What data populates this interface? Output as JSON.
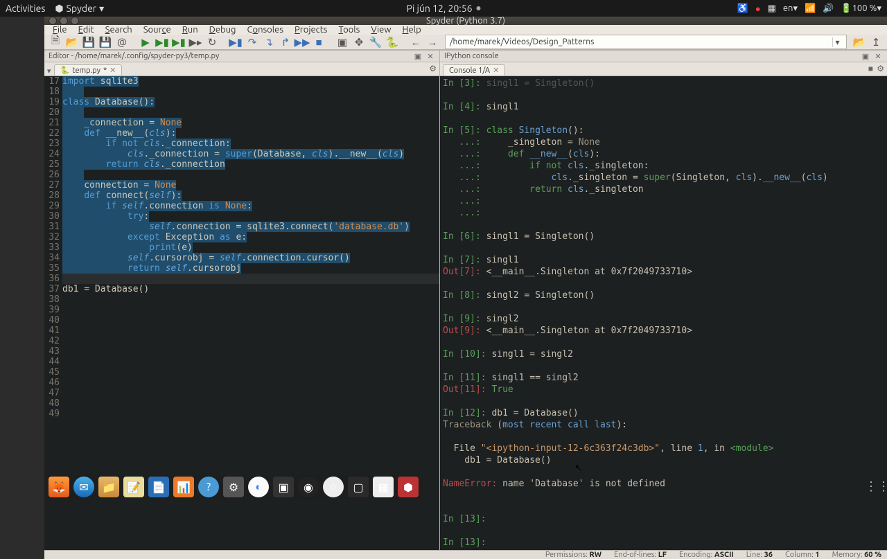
{
  "topbar": {
    "activities": "Activities",
    "app": "Spyder",
    "datetime": "Pi jún 12, 20:56",
    "lang": "en",
    "battery": "100 %"
  },
  "window": {
    "title": "Spyder (Python 3.7)"
  },
  "menu": {
    "items": [
      "File",
      "Edit",
      "Search",
      "Source",
      "Run",
      "Debug",
      "Consoles",
      "Projects",
      "Tools",
      "View",
      "Help"
    ]
  },
  "toolbar": {
    "path": "/home/marek/Videos/Design_Patterns"
  },
  "editor": {
    "header": "Editor - /home/marek/.config/spyder-py3/temp.py",
    "tab": "temp.py",
    "dirty": "*",
    "lines": [
      {
        "n": 17,
        "text": "import sqlite3"
      },
      {
        "n": 18,
        "text": ""
      },
      {
        "n": 19,
        "text": "class Database():"
      },
      {
        "n": 20,
        "text": ""
      },
      {
        "n": 21,
        "text": "    _connection = None"
      },
      {
        "n": 22,
        "text": "    def __new__(cls):"
      },
      {
        "n": 23,
        "text": "        if not cls._connection:"
      },
      {
        "n": 24,
        "text": "            cls._connection = super(Database, cls).__new__(cls)"
      },
      {
        "n": 25,
        "text": "        return cls._connection"
      },
      {
        "n": 26,
        "text": ""
      },
      {
        "n": 27,
        "text": "    connection = None"
      },
      {
        "n": 28,
        "text": "    def connect(self):"
      },
      {
        "n": 29,
        "text": "        if self.connection is None:"
      },
      {
        "n": 30,
        "text": "            try:"
      },
      {
        "n": 31,
        "text": "                self.connection = sqlite3.connect('database.db')"
      },
      {
        "n": 32,
        "text": "            except Exception as e:"
      },
      {
        "n": 33,
        "text": "                print(e)"
      },
      {
        "n": 34,
        "text": "            self.cursorobj = self.connection.cursor()"
      },
      {
        "n": 35,
        "text": "            return self.cursorobj"
      },
      {
        "n": 36,
        "text": ""
      },
      {
        "n": 37,
        "text": "db1 = Database()"
      },
      {
        "n": 38,
        "text": ""
      },
      {
        "n": 39,
        "text": ""
      },
      {
        "n": 40,
        "text": ""
      },
      {
        "n": 41,
        "text": ""
      },
      {
        "n": 42,
        "text": ""
      },
      {
        "n": 43,
        "text": ""
      },
      {
        "n": 44,
        "text": ""
      },
      {
        "n": 45,
        "text": ""
      },
      {
        "n": 46,
        "text": ""
      },
      {
        "n": 47,
        "text": ""
      },
      {
        "n": 48,
        "text": ""
      },
      {
        "n": 49,
        "text": ""
      }
    ]
  },
  "console": {
    "header": "IPython console",
    "tab": "Console 1/A",
    "top_line": {
      "prompt": "In [3]:",
      "text": " singl1 = Singleton()"
    },
    "in4": {
      "prompt": "In [4]:",
      "text": " singl1"
    },
    "in5": {
      "prompt": "In [5]:",
      "head": " class Singleton():",
      "b1": "_singleton = None",
      "b2": "def __new__(cls):",
      "b3": "if not cls._singleton:",
      "b4": "cls._singleton = super(Singleton, cls).__new__(cls)",
      "b5": "return cls._singleton"
    },
    "cont": "   ...:",
    "in6": {
      "prompt": "In [6]:",
      "text": " singl1 = Singleton()"
    },
    "in7": {
      "prompt": "In [7]:",
      "text": " singl1"
    },
    "out7": {
      "prompt": "Out[7]:",
      "text": " <__main__.Singleton at 0x7f2049733710>"
    },
    "in8": {
      "prompt": "In [8]:",
      "text": " singl2 = Singleton()"
    },
    "in9": {
      "prompt": "In [9]:",
      "text": " singl2"
    },
    "out9": {
      "prompt": "Out[9]:",
      "text": " <__main__.Singleton at 0x7f2049733710>"
    },
    "in10": {
      "prompt": "In [10]:",
      "text": " singl1 = singl2"
    },
    "in11": {
      "prompt": "In [11]:",
      "text": " singl1 == singl2"
    },
    "out11": {
      "prompt": "Out[11]:",
      "text": " True"
    },
    "in12": {
      "prompt": "In [12]:",
      "text": " db1 = Database()"
    },
    "tb": "Traceback (most recent call last):",
    "tbfile": "  File \"<ipython-input-12-6c363f24c3db>\", line 1, in <module>",
    "tbline": "    db1 = Database()",
    "nerr": "NameError:",
    "nerr_msg": " name 'Database' is not defined",
    "in13a": {
      "prompt": "In [13]:",
      "text": " "
    },
    "in13b": {
      "prompt": "In [13]:",
      "text": " "
    }
  },
  "status": {
    "perm_lbl": "Permissions:",
    "perm": "RW",
    "eol_lbl": "End-of-lines:",
    "eol": "LF",
    "enc_lbl": "Encoding:",
    "enc": "ASCII",
    "line_lbl": "Line:",
    "line": "36",
    "col_lbl": "Column:",
    "col": "1",
    "mem_lbl": "Memory:",
    "mem": "60 %"
  }
}
